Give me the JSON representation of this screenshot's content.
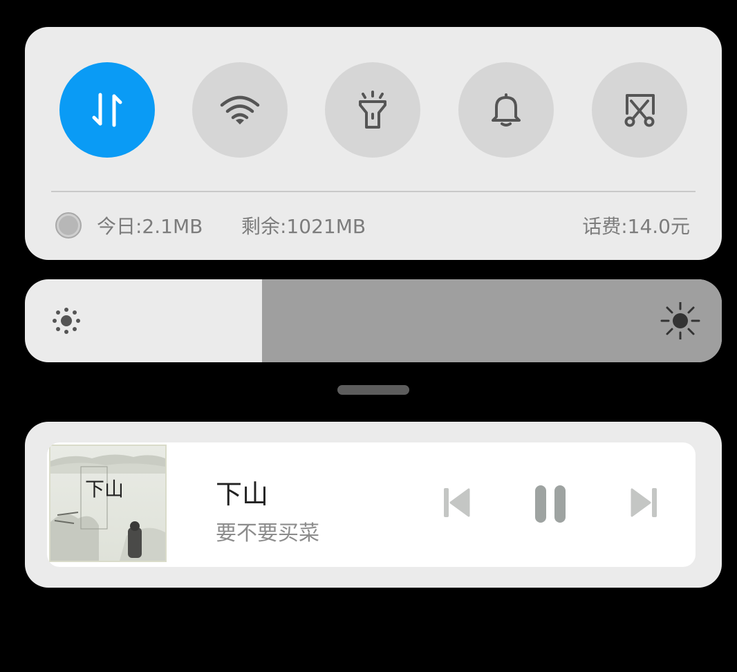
{
  "quick_toggles": [
    {
      "icon": "data-transfer-icon",
      "active": true
    },
    {
      "icon": "wifi-icon",
      "active": false
    },
    {
      "icon": "flashlight-icon",
      "active": false
    },
    {
      "icon": "bell-icon",
      "active": false
    },
    {
      "icon": "screenshot-icon",
      "active": false
    }
  ],
  "usage": {
    "today": "今日:2.1MB",
    "remaining": "剩余:1021MB",
    "balance": "话费:14.0元"
  },
  "brightness": {
    "level": 0.34
  },
  "media": {
    "title": "下山",
    "artist": "要不要买菜",
    "album_art_text": "下山",
    "controls": [
      "previous-icon",
      "pause-icon",
      "next-icon"
    ]
  },
  "colors": {
    "accent": "#0a9bf5",
    "panel": "#ebebeb",
    "toggle_inactive": "#d6d6d6",
    "icon": "#555555"
  }
}
